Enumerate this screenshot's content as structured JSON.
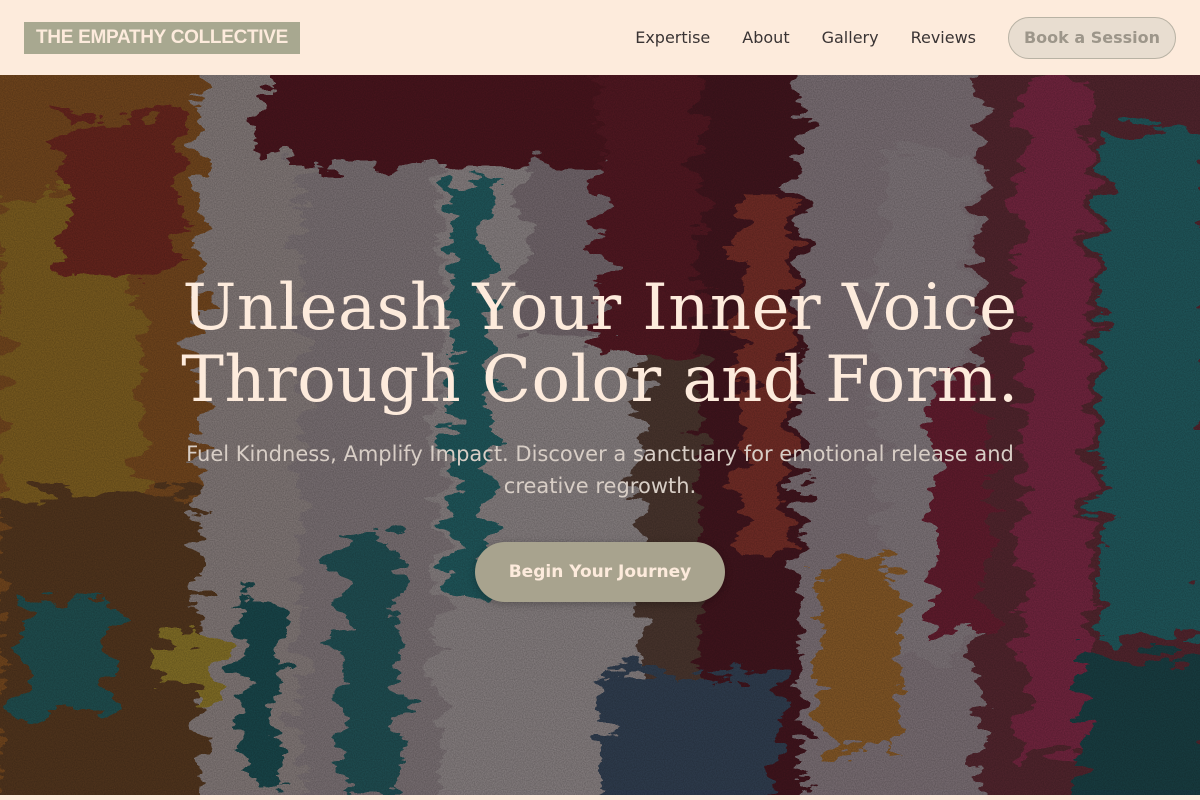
{
  "header": {
    "logo": "THE EMPATHY COLLECTIVE",
    "nav": [
      {
        "label": "Expertise"
      },
      {
        "label": "About"
      },
      {
        "label": "Gallery"
      },
      {
        "label": "Reviews"
      }
    ],
    "book_label": "Book a Session"
  },
  "hero": {
    "title": "Unleash Your Inner Voice Through Color and Form.",
    "subtitle": "Fuel Kindness, Amplify Impact. Discover a sanctuary for emotional release and creative regrowth.",
    "cta_label": "Begin Your Journey",
    "background_image": "abstract-acrylic-paint-texture"
  },
  "colors": {
    "header_bg": "#fdebdc",
    "accent": "#a8a38e",
    "text_light": "#fdebdc"
  }
}
